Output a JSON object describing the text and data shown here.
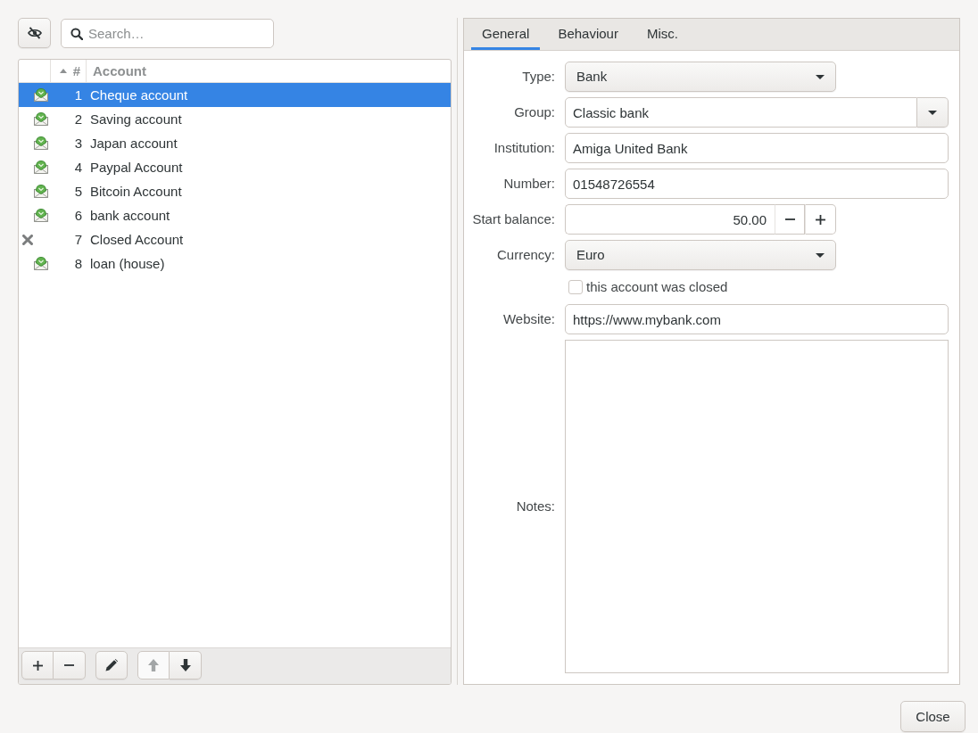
{
  "search": {
    "placeholder": "Search…"
  },
  "accounts": {
    "columns": [
      {
        "label": "#",
        "sorted": true
      },
      {
        "label": "Account",
        "sorted": false
      }
    ],
    "rows": [
      {
        "kind": "open",
        "number": "1",
        "name": "Cheque account",
        "selected": true
      },
      {
        "kind": "open",
        "number": "2",
        "name": "Saving account",
        "selected": false
      },
      {
        "kind": "open",
        "number": "3",
        "name": "Japan account",
        "selected": false
      },
      {
        "kind": "open",
        "number": "4",
        "name": "Paypal Account",
        "selected": false
      },
      {
        "kind": "open",
        "number": "5",
        "name": "Bitcoin Account",
        "selected": false
      },
      {
        "kind": "open",
        "number": "6",
        "name": "bank account",
        "selected": false
      },
      {
        "kind": "closed",
        "number": "7",
        "name": "Closed Account",
        "selected": false
      },
      {
        "kind": "open",
        "number": "8",
        "name": "loan (house)",
        "selected": false
      }
    ]
  },
  "list_actions": [
    {
      "kind": "add",
      "disabled": false
    },
    {
      "kind": "remove",
      "disabled": false
    },
    {
      "kind": "edit",
      "disabled": false
    },
    {
      "kind": "move_up",
      "disabled": true
    },
    {
      "kind": "move_down",
      "disabled": false
    }
  ],
  "tabs": [
    {
      "label": "General",
      "selected": true
    },
    {
      "label": "Behaviour",
      "selected": false
    },
    {
      "label": "Misc.",
      "selected": false
    }
  ],
  "fields": [
    {
      "kind": "select",
      "label": "Type:",
      "value": "Bank"
    },
    {
      "kind": "combo_entry",
      "label": "Group:",
      "value": "Classic bank"
    },
    {
      "kind": "text",
      "label": "Institution:",
      "value": "Amiga United Bank"
    },
    {
      "kind": "text",
      "label": "Number:",
      "value": "01548726554"
    },
    {
      "kind": "spin",
      "label": "Start balance:",
      "value": "50.00"
    },
    {
      "kind": "select",
      "label": "Currency:",
      "value": "Euro"
    },
    {
      "kind": "checkbox",
      "text": "this account was closed",
      "checked": false
    },
    {
      "kind": "text",
      "label": "Website:",
      "value": "https://www.mybank.com"
    },
    {
      "kind": "textarea",
      "label": "Notes:"
    }
  ],
  "close_button": {
    "label": "Close"
  }
}
